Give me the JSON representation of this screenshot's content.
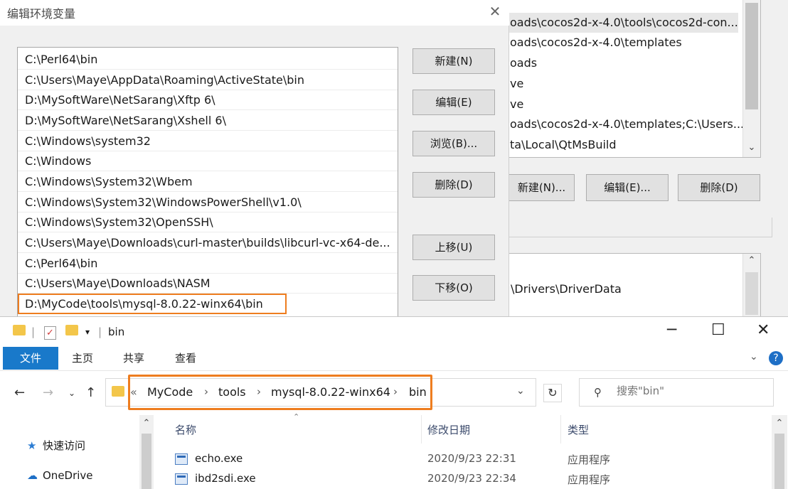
{
  "edit_dialog": {
    "title": "编辑环境变量",
    "paths": [
      "C:\\Perl64\\bin",
      "C:\\Users\\Maye\\AppData\\Roaming\\ActiveState\\bin",
      "D:\\MySoftWare\\NetSarang\\Xftp 6\\",
      "D:\\MySoftWare\\NetSarang\\Xshell 6\\",
      "C:\\Windows\\system32",
      "C:\\Windows",
      "C:\\Windows\\System32\\Wbem",
      "C:\\Windows\\System32\\WindowsPowerShell\\v1.0\\",
      "C:\\Windows\\System32\\OpenSSH\\",
      "C:\\Users\\Maye\\Downloads\\curl-master\\builds\\libcurl-vc-x64-de...",
      "C:\\Perl64\\bin",
      "C:\\Users\\Maye\\Downloads\\NASM",
      "D:\\MyCode\\tools\\mysql-8.0.22-winx64\\bin"
    ],
    "buttons": {
      "new": "新建(N)",
      "edit": "编辑(E)",
      "browse": "浏览(B)...",
      "delete": "删除(D)",
      "move_up": "上移(U)",
      "move_down": "下移(O)"
    }
  },
  "bg_dialog": {
    "user_vars": [
      "oads\\cocos2d-x-4.0\\tools\\cocos2d-con...",
      "oads\\cocos2d-x-4.0\\templates",
      "oads",
      "ve",
      "ve",
      "oads\\cocos2d-x-4.0\\templates;C:\\Users...",
      "ta\\Local\\QtMsBuild"
    ],
    "buttons": {
      "new": "新建(N)...",
      "edit": "编辑(E)...",
      "delete": "删除(D)"
    },
    "sys_var": "\\Drivers\\DriverData"
  },
  "explorer": {
    "window_title": "bin",
    "tabs": {
      "file": "文件",
      "home": "主页",
      "share": "共享",
      "view": "查看"
    },
    "breadcrumb": {
      "overflow": "«",
      "items": [
        "MyCode",
        "tools",
        "mysql-8.0.22-winx64",
        "bin"
      ]
    },
    "search_placeholder": "搜索\"bin\"",
    "nav_items": [
      "快速访问",
      "OneDrive"
    ],
    "columns": {
      "name": "名称",
      "date": "修改日期",
      "type": "类型"
    },
    "files": [
      {
        "name": "echo.exe",
        "date": "2020/9/23 22:31",
        "type": "应用程序"
      },
      {
        "name": "ibd2sdi.exe",
        "date": "2020/9/23 22:34",
        "type": "应用程序"
      }
    ]
  },
  "colors": {
    "highlight": "#ee7d1f",
    "file_tab": "#1979ca"
  }
}
